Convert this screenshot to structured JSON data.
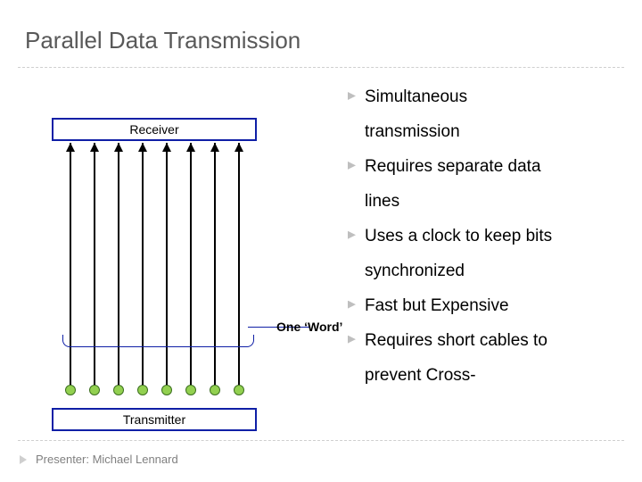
{
  "title": "Parallel Data Transmission",
  "diagram": {
    "receiver_label": "Receiver",
    "transmitter_label": "Transmitter",
    "word_label": "One ‘Word’",
    "wire_count": 8
  },
  "bullets": {
    "text0": "Simultaneous",
    "text1": "transmission",
    "text2": "Requires separate data",
    "text3": "lines",
    "text4": "Uses a clock to keep bits",
    "text5": "synchronized",
    "text6": "Fast but Expensive",
    "text7": "Requires short cables to",
    "text8": "prevent Cross-"
  },
  "footer": {
    "presenter": "Presenter: Michael Lennard"
  }
}
